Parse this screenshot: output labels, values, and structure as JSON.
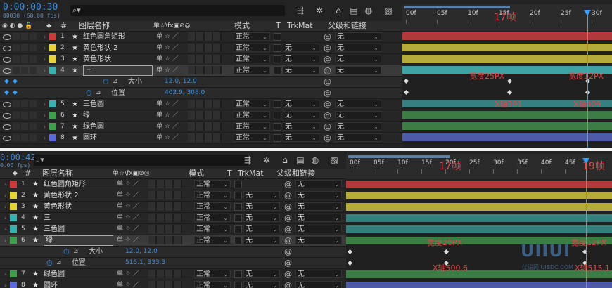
{
  "top": {
    "timecode": "0:00:00:30",
    "timecode_sub": "00030 (60.00 fps)",
    "search_placeholder": "",
    "headers": {
      "label_tag": "#",
      "name": "图层名称",
      "switches": "单☆\\fx▣⊘◎",
      "mode": "模式",
      "t": "T",
      "trkmat": "TrkMat",
      "parent": "父级和链接"
    },
    "ruler_ticks": [
      "00f",
      "05f",
      "10f",
      "15f",
      "20f",
      "25f",
      "30f"
    ],
    "layers": [
      {
        "num": "1",
        "name": "红色圆角矩形",
        "color": "#c83c3c",
        "mode": "正常",
        "trk": "",
        "parent": "无",
        "track_color": "#b03a3a"
      },
      {
        "num": "2",
        "name": "黄色形状 2",
        "color": "#e6d23c",
        "mode": "正常",
        "trk": "无",
        "parent": "无",
        "track_color": "#b5aa3c"
      },
      {
        "num": "3",
        "name": "黄色形状",
        "color": "#e6d23c",
        "mode": "正常",
        "trk": "无",
        "parent": "无",
        "track_color": "#b5aa3c"
      },
      {
        "num": "4",
        "name": "三",
        "color": "#3cb0b0",
        "mode": "正常",
        "trk": "无",
        "parent": "无",
        "track_color": "#3fa3a3"
      }
    ],
    "props": [
      {
        "name": "大小",
        "value": "12.0, 12.0"
      },
      {
        "name": "位置",
        "value": "402.9, 308.0"
      }
    ],
    "layers_after": [
      {
        "num": "5",
        "name": "三色圆",
        "color": "#3cb0b0",
        "mode": "正常",
        "trk": "无",
        "parent": "无",
        "track_color": "#357f7f"
      },
      {
        "num": "6",
        "name": "绿",
        "color": "#3ca04a",
        "mode": "正常",
        "trk": "无",
        "parent": "无",
        "track_color": "#3c7d45"
      },
      {
        "num": "7",
        "name": "绿色圆",
        "color": "#3ca04a",
        "mode": "正常",
        "trk": "无",
        "parent": "无",
        "track_color": "#3c7d45"
      },
      {
        "num": "8",
        "name": "圆环",
        "color": "#5a6ad6",
        "mode": "正常",
        "trk": "无",
        "parent": "无",
        "track_color": "#4d5aa8"
      }
    ],
    "annotations": {
      "frames": "17帧",
      "w1": "宽度25PX",
      "w2": "宽度12PX",
      "x1": "X轴391",
      "x2": "X轴409"
    }
  },
  "bottom": {
    "timecode": "0:00:42",
    "timecode_sub": "0.00 fps)",
    "headers": {
      "label_tag": "#",
      "name": "图层名称",
      "switches": "单☆\\fx▣⊘◎",
      "mode": "模式",
      "t": "T",
      "trkmat": "TrkMat",
      "parent": "父级和链接"
    },
    "ruler_ticks": [
      "00f",
      "05f",
      "10f",
      "15f",
      "20f",
      "25f",
      "30f",
      "35f",
      "40f",
      "45f"
    ],
    "layers": [
      {
        "num": "1",
        "name": "红色圆角矩形",
        "color": "#c83c3c",
        "mode": "正常",
        "trk": "",
        "parent": "无",
        "track_color": "#b03a3a"
      },
      {
        "num": "2",
        "name": "黄色形状 2",
        "color": "#e6d23c",
        "mode": "正常",
        "trk": "无",
        "parent": "无",
        "track_color": "#b5aa3c"
      },
      {
        "num": "3",
        "name": "黄色形状",
        "color": "#e6d23c",
        "mode": "正常",
        "trk": "无",
        "parent": "无",
        "track_color": "#b5aa3c"
      },
      {
        "num": "4",
        "name": "三",
        "color": "#3cb0b0",
        "mode": "正常",
        "trk": "无",
        "parent": "无",
        "track_color": "#357f7f"
      },
      {
        "num": "5",
        "name": "三色圆",
        "color": "#3cb0b0",
        "mode": "正常",
        "trk": "无",
        "parent": "无",
        "track_color": "#357f7f"
      },
      {
        "num": "6",
        "name": "绿",
        "color": "#3ca04a",
        "mode": "正常",
        "trk": "无",
        "parent": "无",
        "track_color": "#3c7d45"
      }
    ],
    "props": [
      {
        "name": "大小",
        "value": "12.0, 12.0"
      },
      {
        "name": "位置",
        "value": "515.1, 333.3"
      }
    ],
    "layers_after": [
      {
        "num": "7",
        "name": "绿色圆",
        "color": "#3ca04a",
        "mode": "正常",
        "trk": "无",
        "parent": "无",
        "track_color": "#3c7d45"
      },
      {
        "num": "8",
        "name": "圆环",
        "color": "#5a6ad6",
        "mode": "正常",
        "trk": "无",
        "parent": "无",
        "track_color": "#4d5aa8"
      }
    ],
    "annotations": {
      "frames1": "17帧",
      "frames2": "19帧",
      "w1": "宽度20PX",
      "w2": "宽度12PX",
      "x1": "X轴500.6",
      "x2": "X轴515.1"
    },
    "watermark": {
      "mark": "UIIUI",
      "sub": "优设网 UISDC.COM"
    }
  }
}
